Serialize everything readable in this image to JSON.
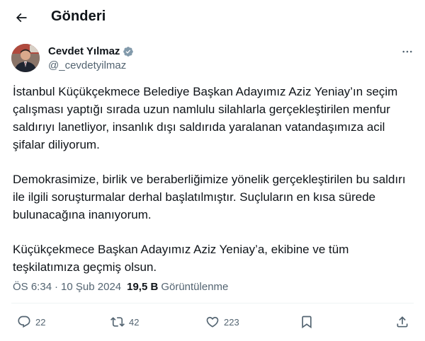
{
  "header": {
    "title": "Gönderi"
  },
  "author": {
    "name": "Cevdet Yılmaz",
    "handle": "@_cevdetyilmaz"
  },
  "tweet": {
    "paragraphs": [
      "İstanbul Küçükçekmece Belediye Başkan Adayımız Aziz Yeniay’ın seçim çalışması yaptığı sırada uzun namlulu silahlarla gerçekleştirilen menfur saldırıyı lanetliyor, insanlık dışı saldırıda yaralanan vatandaşımıza acil şifalar diliyorum.",
      "Demokrasimize, birlik ve beraberliğimize yönelik gerçekleştirilen bu saldırı ile ilgili soruşturmalar derhal başlatılmıştır. Suçluların en kısa sürede bulunacağına inanıyorum.",
      "Küçükçekmece Başkan Adayımız Aziz Yeniay’a, ekibine ve tüm teşkilatımıza geçmiş olsun."
    ]
  },
  "meta": {
    "time": "ÖS 6:34",
    "separator": "·",
    "date": "10 Şub 2024",
    "views_count": "19,5 B",
    "views_label": "Görüntülenme"
  },
  "actions": {
    "replies": "22",
    "reposts": "42",
    "likes": "223"
  },
  "icons": {
    "back": "arrow-left-icon",
    "verified": "verified-badge-icon",
    "more": "more-horizontal-icon",
    "reply": "reply-icon",
    "repost": "repost-icon",
    "like": "heart-icon",
    "bookmark": "bookmark-icon",
    "share": "share-icon"
  },
  "colors": {
    "text": "#0f1419",
    "secondary": "#536471",
    "verified": "#829aab",
    "divider": "#eff3f4"
  }
}
